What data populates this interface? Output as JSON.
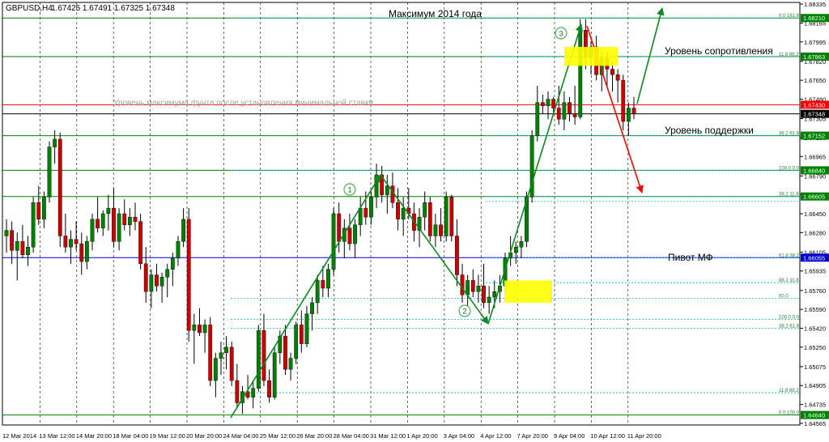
{
  "header": {
    "symbol": "GBPUSD,H4",
    "ohlc": "1.67425 1.67491 1.67325 1.67348"
  },
  "chart_data": {
    "type": "candlestick",
    "ylim": [
      1.6455,
      1.6835
    ],
    "price_ticks": [
      1.68335,
      1.68165,
      1.67995,
      1.6782,
      1.6765,
      1.6748,
      1.67305,
      1.67135,
      1.66965,
      1.6679,
      1.6662,
      1.6645,
      1.6628,
      1.66105,
      1.65935,
      1.6576,
      1.6559,
      1.6542,
      1.6525,
      1.65075,
      1.64905,
      1.64735,
      1.64565
    ],
    "time_labels": [
      "12 Mar 2014",
      "13 Mar 12:00",
      "14 Mar 20:00",
      "18 Mar 04:00",
      "19 Mar 12:00",
      "20 Mar 20:00",
      "24 Mar 04:00",
      "25 Mar 12:00",
      "26 Mar 20:00",
      "28 Mar 04:00",
      "31 Mar 12:00",
      "1 Apr 20:00",
      "3 Apr 04:00",
      "4 Apr 12:00",
      "7 Apr 20:00",
      "9 Apr 04:00",
      "10 Apr 12:00",
      "11 Apr 20:00"
    ],
    "levels": [
      {
        "price": 1.6821,
        "label": "1.68210",
        "color": "#008000"
      },
      {
        "price": 1.67863,
        "label": "1.67863",
        "color": "#008000"
      },
      {
        "price": 1.6743,
        "label": "1.67430",
        "color": "#ff0000"
      },
      {
        "price": 1.67348,
        "label": "1.67348",
        "color": "#000000"
      },
      {
        "price": 1.67152,
        "label": "1.67152",
        "color": "#008000"
      },
      {
        "price": 1.6684,
        "label": "1.66840",
        "color": "#008000"
      },
      {
        "price": 1.66605,
        "label": "1.66605",
        "color": "#008000"
      },
      {
        "price": 1.66055,
        "label": "1.66055",
        "color": "#0000cc"
      },
      {
        "price": 1.6464,
        "label": "1.64640",
        "color": "#008000"
      }
    ],
    "fib_labels": [
      {
        "price": 1.6821,
        "text": "0.0 161.8"
      },
      {
        "price": 1.67863,
        "text": "11.8 88.2"
      },
      {
        "price": 1.67152,
        "text": "38.2 61.8"
      },
      {
        "price": 1.6684,
        "text": "100.0 0.0"
      },
      {
        "price": 1.66605,
        "text": "38.2 11.8"
      },
      {
        "price": 1.66055,
        "text": "61.8 38.2"
      },
      {
        "price": 1.6583,
        "text": "88.2 11.8"
      },
      {
        "price": 1.6569,
        "text": "50.0"
      },
      {
        "price": 1.655,
        "text": "100.0 0.0"
      },
      {
        "price": 1.6542,
        "text": "38.2 61.8"
      },
      {
        "price": 1.6484,
        "text": "11.8 88.2"
      },
      {
        "price": 1.6464,
        "text": "0.0 100.0"
      }
    ],
    "annotations": {
      "max_2014": "Максимум 2014 года",
      "resistance": "Уровень сопротивления",
      "max_note": "Уровень максимума фунта после установления минимальной ставки",
      "support": "Уровень поддержки",
      "pivot": "Пивот МФ"
    },
    "wave_markers": [
      "1",
      "2",
      "3"
    ],
    "candles": [
      [
        1.6625,
        1.664,
        1.661,
        1.663
      ],
      [
        1.663,
        1.6638,
        1.66,
        1.6612
      ],
      [
        1.6612,
        1.6628,
        1.6585,
        1.662
      ],
      [
        1.662,
        1.6635,
        1.6605,
        1.6608
      ],
      [
        1.6608,
        1.6625,
        1.6598,
        1.6615
      ],
      [
        1.6615,
        1.666,
        1.661,
        1.6655
      ],
      [
        1.6655,
        1.667,
        1.6635,
        1.664
      ],
      [
        1.664,
        1.6665,
        1.6632,
        1.666
      ],
      [
        1.666,
        1.671,
        1.6655,
        1.6705
      ],
      [
        1.6705,
        1.672,
        1.669,
        1.6712
      ],
      [
        1.6712,
        1.6718,
        1.6615,
        1.6625
      ],
      [
        1.6625,
        1.6645,
        1.661,
        1.6615
      ],
      [
        1.6615,
        1.663,
        1.66,
        1.6622
      ],
      [
        1.6622,
        1.6638,
        1.6612,
        1.6618
      ],
      [
        1.6618,
        1.6628,
        1.659,
        1.6602
      ],
      [
        1.6602,
        1.6625,
        1.6595,
        1.662
      ],
      [
        1.662,
        1.6645,
        1.6612,
        1.664
      ],
      [
        1.664,
        1.666,
        1.6628,
        1.6632
      ],
      [
        1.6632,
        1.6648,
        1.6625,
        1.6645
      ],
      [
        1.6645,
        1.6662,
        1.663,
        1.665
      ],
      [
        1.665,
        1.6668,
        1.6615,
        1.662
      ],
      [
        1.662,
        1.665,
        1.6612,
        1.6645
      ],
      [
        1.6645,
        1.6658,
        1.663,
        1.6635
      ],
      [
        1.6635,
        1.665,
        1.6625,
        1.6642
      ],
      [
        1.6642,
        1.6655,
        1.663,
        1.6638
      ],
      [
        1.6638,
        1.6645,
        1.6595,
        1.66
      ],
      [
        1.66,
        1.6615,
        1.6565,
        1.6575
      ],
      [
        1.6575,
        1.6595,
        1.656,
        1.659
      ],
      [
        1.659,
        1.66,
        1.6575,
        1.658
      ],
      [
        1.658,
        1.6592,
        1.6565,
        1.6588
      ],
      [
        1.6588,
        1.66,
        1.657,
        1.6595
      ],
      [
        1.6595,
        1.661,
        1.658,
        1.6605
      ],
      [
        1.6605,
        1.6625,
        1.6598,
        1.662
      ],
      [
        1.662,
        1.665,
        1.6615,
        1.664
      ],
      [
        1.664,
        1.665,
        1.653,
        1.654
      ],
      [
        1.654,
        1.6555,
        1.651,
        1.6545
      ],
      [
        1.6545,
        1.656,
        1.6535,
        1.6538
      ],
      [
        1.6538,
        1.655,
        1.652,
        1.6545
      ],
      [
        1.6545,
        1.6552,
        1.649,
        1.6495
      ],
      [
        1.6495,
        1.652,
        1.648,
        1.6515
      ],
      [
        1.6515,
        1.653,
        1.65,
        1.652
      ],
      [
        1.652,
        1.6535,
        1.6505,
        1.6525
      ],
      [
        1.6525,
        1.653,
        1.649,
        1.6495
      ],
      [
        1.6495,
        1.651,
        1.647,
        1.6475
      ],
      [
        1.6475,
        1.649,
        1.6465,
        1.6485
      ],
      [
        1.6485,
        1.65,
        1.6478,
        1.648
      ],
      [
        1.648,
        1.6495,
        1.647,
        1.6488
      ],
      [
        1.6488,
        1.6545,
        1.6485,
        1.654
      ],
      [
        1.654,
        1.6555,
        1.649,
        1.6495
      ],
      [
        1.6495,
        1.6505,
        1.6475,
        1.648
      ],
      [
        1.648,
        1.6525,
        1.6478,
        1.652
      ],
      [
        1.652,
        1.654,
        1.651,
        1.6535
      ],
      [
        1.6535,
        1.6545,
        1.65,
        1.6505
      ],
      [
        1.6505,
        1.652,
        1.6495,
        1.6515
      ],
      [
        1.6515,
        1.6548,
        1.651,
        1.6545
      ],
      [
        1.6545,
        1.6558,
        1.652,
        1.6528
      ],
      [
        1.6528,
        1.6562,
        1.6525,
        1.6555
      ],
      [
        1.6555,
        1.657,
        1.654,
        1.6565
      ],
      [
        1.6565,
        1.659,
        1.6555,
        1.6585
      ],
      [
        1.6585,
        1.6598,
        1.657,
        1.6578
      ],
      [
        1.6578,
        1.66,
        1.657,
        1.6595
      ],
      [
        1.6595,
        1.665,
        1.659,
        1.6645
      ],
      [
        1.6645,
        1.6655,
        1.661,
        1.662
      ],
      [
        1.662,
        1.664,
        1.6605,
        1.6632
      ],
      [
        1.6632,
        1.6645,
        1.6612,
        1.6618
      ],
      [
        1.6618,
        1.664,
        1.6605,
        1.6635
      ],
      [
        1.6635,
        1.666,
        1.6625,
        1.665
      ],
      [
        1.665,
        1.6665,
        1.6635,
        1.6642
      ],
      [
        1.6642,
        1.6665,
        1.6635,
        1.666
      ],
      [
        1.666,
        1.669,
        1.665,
        1.668
      ],
      [
        1.668,
        1.6688,
        1.6655,
        1.6662
      ],
      [
        1.6662,
        1.668,
        1.6645,
        1.667
      ],
      [
        1.667,
        1.6682,
        1.665,
        1.6655
      ],
      [
        1.6655,
        1.6668,
        1.663,
        1.664
      ],
      [
        1.664,
        1.666,
        1.6625,
        1.665
      ],
      [
        1.665,
        1.6668,
        1.664,
        1.6645
      ],
      [
        1.6645,
        1.6655,
        1.662,
        1.663
      ],
      [
        1.663,
        1.665,
        1.6615,
        1.6642
      ],
      [
        1.6642,
        1.6665,
        1.663,
        1.6655
      ],
      [
        1.6655,
        1.666,
        1.662,
        1.6625
      ],
      [
        1.6625,
        1.6645,
        1.6615,
        1.6635
      ],
      [
        1.6635,
        1.665,
        1.662,
        1.6625
      ],
      [
        1.6625,
        1.6665,
        1.662,
        1.666
      ],
      [
        1.666,
        1.6662,
        1.662,
        1.6625
      ],
      [
        1.6625,
        1.664,
        1.658,
        1.659
      ],
      [
        1.659,
        1.66,
        1.6565,
        1.6572
      ],
      [
        1.6572,
        1.659,
        1.656,
        1.6585
      ],
      [
        1.6585,
        1.6595,
        1.657,
        1.6575
      ],
      [
        1.6575,
        1.659,
        1.6565,
        1.658
      ],
      [
        1.658,
        1.66,
        1.656,
        1.6565
      ],
      [
        1.6565,
        1.658,
        1.6555,
        1.657
      ],
      [
        1.657,
        1.6585,
        1.656,
        1.6575
      ],
      [
        1.6575,
        1.659,
        1.6565,
        1.658
      ],
      [
        1.658,
        1.661,
        1.6575,
        1.6605
      ],
      [
        1.6605,
        1.6625,
        1.6598,
        1.661
      ],
      [
        1.661,
        1.662,
        1.66,
        1.6615
      ],
      [
        1.6615,
        1.6625,
        1.6605,
        1.662
      ],
      [
        1.662,
        1.6665,
        1.6615,
        1.666
      ],
      [
        1.666,
        1.672,
        1.6655,
        1.6715
      ],
      [
        1.6715,
        1.676,
        1.671,
        1.6745
      ],
      [
        1.6745,
        1.6752,
        1.6735,
        1.6742
      ],
      [
        1.6742,
        1.6755,
        1.673,
        1.6748
      ],
      [
        1.6748,
        1.675,
        1.6735,
        1.674
      ],
      [
        1.674,
        1.676,
        1.6725,
        1.673
      ],
      [
        1.673,
        1.6755,
        1.672,
        1.6745
      ],
      [
        1.6745,
        1.675,
        1.6728,
        1.6735
      ],
      [
        1.6735,
        1.676,
        1.6725,
        1.6732
      ],
      [
        1.6732,
        1.682,
        1.673,
        1.681
      ],
      [
        1.681,
        1.682,
        1.6775,
        1.6785
      ],
      [
        1.6785,
        1.68,
        1.677,
        1.6795
      ],
      [
        1.6795,
        1.6805,
        1.6765,
        1.677
      ],
      [
        1.677,
        1.679,
        1.6755,
        1.6785
      ],
      [
        1.6785,
        1.679,
        1.676,
        1.6775
      ],
      [
        1.6775,
        1.6782,
        1.6755,
        1.677
      ],
      [
        1.677,
        1.6775,
        1.6745,
        1.6765
      ],
      [
        1.6765,
        1.677,
        1.672,
        1.6728
      ],
      [
        1.6728,
        1.6745,
        1.6715,
        1.674
      ],
      [
        1.674,
        1.675,
        1.673,
        1.6735
      ]
    ]
  }
}
